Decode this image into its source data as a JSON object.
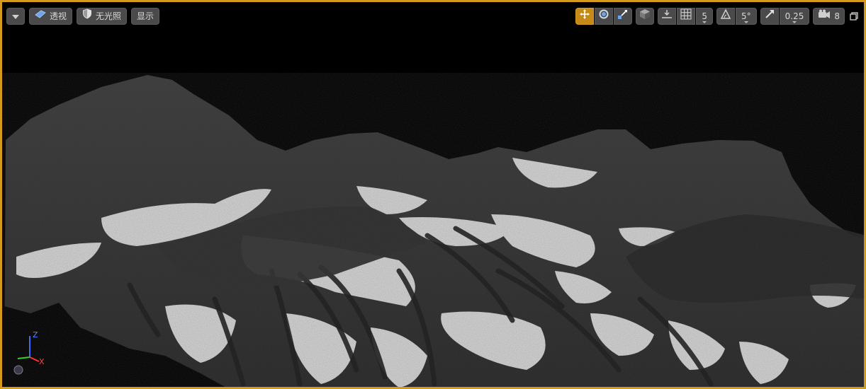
{
  "viewport": {
    "border_color": "#d49a1e",
    "background": "#000000"
  },
  "toolbar_left": {
    "menu_icon": "chevron-down-icon",
    "perspective_label": "透视",
    "lighting_label": "无光照",
    "show_label": "显示"
  },
  "toolbar_right": {
    "transform_icons": [
      "translate-icon",
      "rotate-icon",
      "scale-icon"
    ],
    "world_local_icon": "cube-icon",
    "surface_snap_icon": "surface-snap-icon",
    "grid_icon": "grid-icon",
    "grid_snap_value": "5",
    "rotation_icon": "angle-icon",
    "rotation_snap_value": "5°",
    "scale_icon": "scale-snap-icon",
    "scale_snap_value": "0.25",
    "camera_speed_icon": "camera-icon",
    "camera_speed_value": "8",
    "maximize_icon": "maximize-icon",
    "accent_color": "#c68a16"
  },
  "axis_gizmo": {
    "z_label": "Z",
    "x_label": "X",
    "z_color": "#3c6cff",
    "x_color": "#ff3030",
    "y_color": "#30d030"
  }
}
